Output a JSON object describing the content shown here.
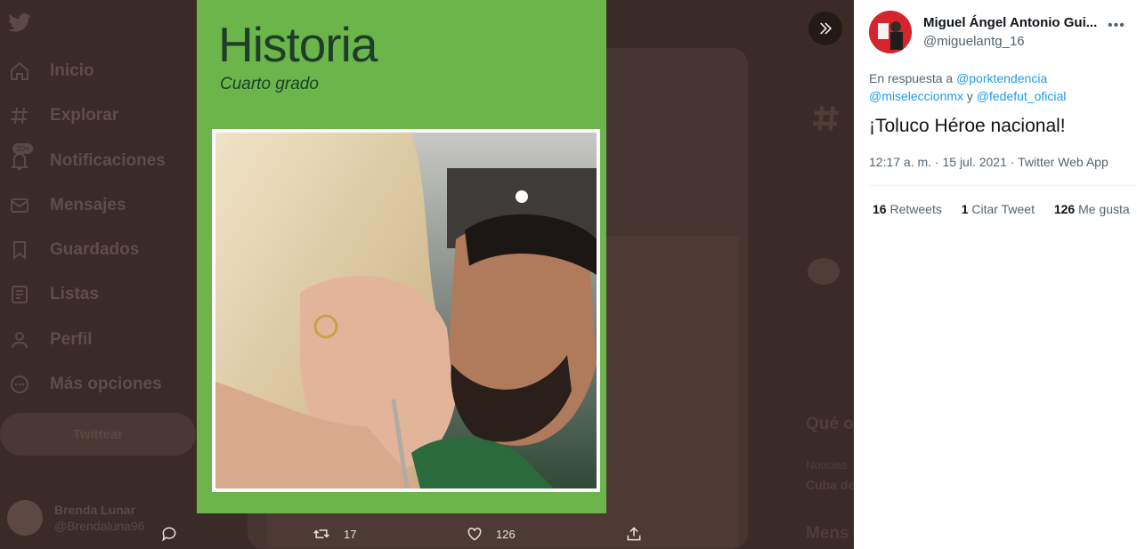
{
  "sidebar": {
    "items": [
      {
        "label": "Inicio",
        "icon": "home-icon"
      },
      {
        "label": "Explorar",
        "icon": "hashtag-icon"
      },
      {
        "label": "Notificaciones",
        "icon": "bell-icon",
        "badge": "20+"
      },
      {
        "label": "Mensajes",
        "icon": "mail-icon"
      },
      {
        "label": "Guardados",
        "icon": "bookmark-icon"
      },
      {
        "label": "Listas",
        "icon": "list-icon"
      },
      {
        "label": "Perfil",
        "icon": "person-icon"
      },
      {
        "label": "Más opciones",
        "icon": "more-circle-icon"
      }
    ],
    "tweet_button": "Twittear",
    "account": {
      "name": "Brenda Lunar",
      "handle": "@Brendaluna96"
    }
  },
  "timeline": {
    "trends_title": "Qué o",
    "trend_category": "Noticias",
    "trend_name": "Cuba de",
    "messages_label": "Mens"
  },
  "media": {
    "book_title": "Historia",
    "book_subtitle": "Cuarto grado"
  },
  "actions": {
    "retweets": "17",
    "likes": "126"
  },
  "tweet": {
    "author_name": "Miguel Ángel Antonio Gui...",
    "author_handle": "@miguelantg_16",
    "reply_prefix": "En respuesta a",
    "mention1": "@porktendencia",
    "mention2": "@miseleccionmx",
    "reply_and": "y",
    "mention3": "@fedefut_oficial",
    "text": "¡Toluco Héroe nacional!",
    "meta": "12:17 a. m. · 15 jul. 2021 · Twitter Web App",
    "retweet_count": "16",
    "retweet_label": "Retweets",
    "quote_count": "1",
    "quote_label": "Citar Tweet",
    "like_count": "126",
    "like_label": "Me gusta"
  },
  "colors": {
    "accent": "#1d9bf0",
    "book_green": "#6bb54a",
    "overlay": "#3a2b27"
  }
}
